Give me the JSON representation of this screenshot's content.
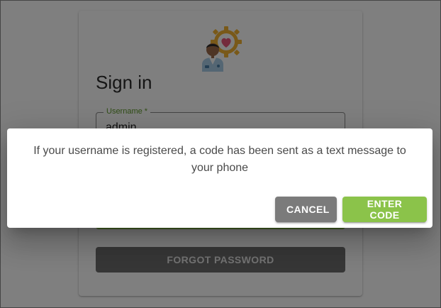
{
  "signin": {
    "title": "Sign in",
    "username_label": "Username *",
    "username_value": "admin",
    "forgot_password": "FORGOT PASSWORD"
  },
  "dialog": {
    "message": "If your username is registered, a code has been sent as a text message to your phone",
    "cancel": "CANCEL",
    "enter_code": "ENTER CODE"
  },
  "colors": {
    "accent_green": "#8bc34a",
    "label_green": "#5f9a2a",
    "cancel_gray": "#7b7b7b"
  },
  "icons": {
    "logo": "doctor-gear-heart-icon"
  }
}
